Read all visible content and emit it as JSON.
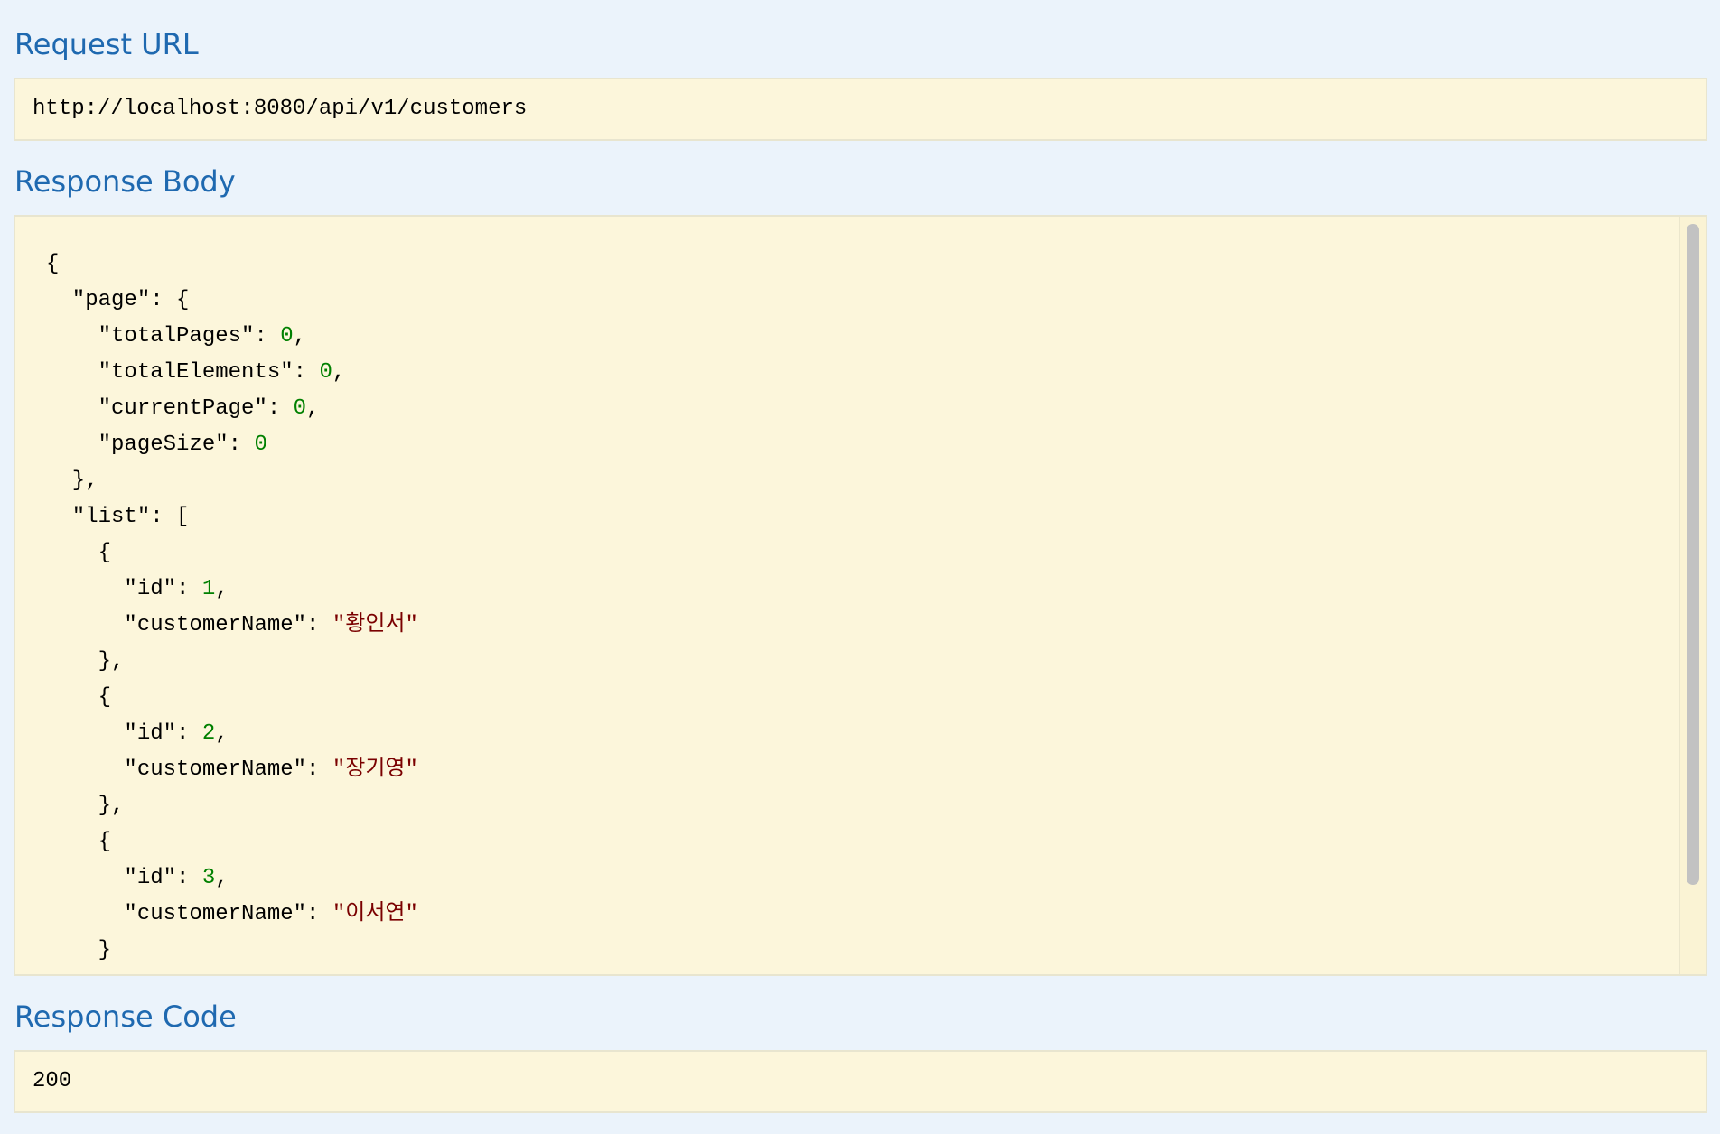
{
  "request_url": {
    "title": "Request URL",
    "value": "http://localhost:8080/api/v1/customers"
  },
  "response_body": {
    "title": "Response Body",
    "open_brace": "{",
    "page_key": "page",
    "page_fields": [
      {
        "key": "totalPages",
        "value": "0"
      },
      {
        "key": "totalElements",
        "value": "0"
      },
      {
        "key": "currentPage",
        "value": "0"
      },
      {
        "key": "pageSize",
        "value": "0"
      }
    ],
    "list_key": "list",
    "list": [
      {
        "id": "1",
        "customerName": "황인서"
      },
      {
        "id": "2",
        "customerName": "장기영"
      },
      {
        "id": "3",
        "customerName": "이서연"
      }
    ]
  },
  "response_code": {
    "title": "Response Code",
    "value": "200"
  },
  "colors": {
    "background": "#ebf3fb",
    "title": "#1f69b0",
    "box_background": "#fcf6db",
    "number": "#008000",
    "string": "#7a0000"
  }
}
